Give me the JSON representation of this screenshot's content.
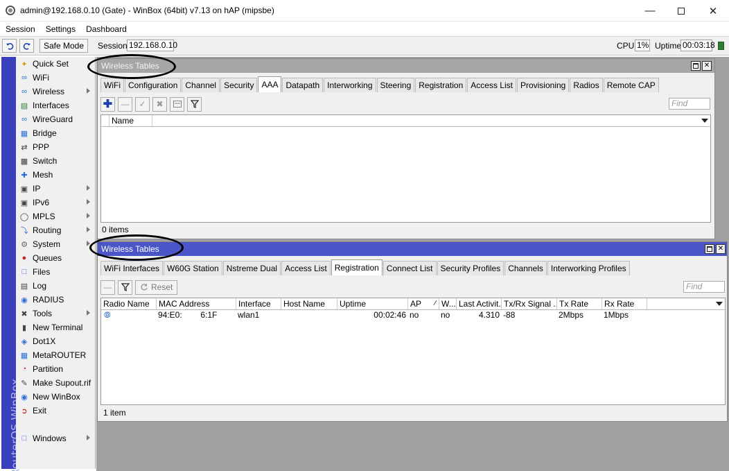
{
  "window": {
    "title": "admin@192.168.0.10 (Gate) - WinBox (64bit) v7.13 on hAP (mipsbe)"
  },
  "menubar": [
    "Session",
    "Settings",
    "Dashboard"
  ],
  "toolbar": {
    "safe_mode_label": "Safe Mode",
    "session_label": "Session:",
    "session_value": "192.168.0.10",
    "cpu_label": "CPU:",
    "cpu_value": "1%",
    "uptime_label": "Uptime:",
    "uptime_value": "00:03:18"
  },
  "brand_strip_text": "RouterOS WinBox",
  "sidebar": {
    "items": [
      {
        "label": "Quick Set",
        "icon": "wand-icon",
        "submenu": false
      },
      {
        "label": "WiFi",
        "icon": "wifi-icon",
        "submenu": false
      },
      {
        "label": "Wireless",
        "icon": "wireless-icon",
        "submenu": true
      },
      {
        "label": "Interfaces",
        "icon": "interfaces-icon",
        "submenu": false
      },
      {
        "label": "WireGuard",
        "icon": "wireguard-icon",
        "submenu": false
      },
      {
        "label": "Bridge",
        "icon": "bridge-icon",
        "submenu": false
      },
      {
        "label": "PPP",
        "icon": "ppp-icon",
        "submenu": false
      },
      {
        "label": "Switch",
        "icon": "switch-icon",
        "submenu": false
      },
      {
        "label": "Mesh",
        "icon": "mesh-icon",
        "submenu": false
      },
      {
        "label": "IP",
        "icon": "ip-icon",
        "submenu": true
      },
      {
        "label": "IPv6",
        "icon": "ipv6-icon",
        "submenu": true
      },
      {
        "label": "MPLS",
        "icon": "mpls-icon",
        "submenu": true
      },
      {
        "label": "Routing",
        "icon": "routing-icon",
        "submenu": true
      },
      {
        "label": "System",
        "icon": "gear-icon",
        "submenu": true
      },
      {
        "label": "Queues",
        "icon": "queues-icon",
        "submenu": false
      },
      {
        "label": "Files",
        "icon": "folder-icon",
        "submenu": false
      },
      {
        "label": "Log",
        "icon": "log-icon",
        "submenu": false
      },
      {
        "label": "RADIUS",
        "icon": "radius-icon",
        "submenu": false
      },
      {
        "label": "Tools",
        "icon": "tools-icon",
        "submenu": true
      },
      {
        "label": "New Terminal",
        "icon": "terminal-icon",
        "submenu": false
      },
      {
        "label": "Dot1X",
        "icon": "dot1x-icon",
        "submenu": false
      },
      {
        "label": "MetaROUTER",
        "icon": "metarouter-icon",
        "submenu": false
      },
      {
        "label": "Partition",
        "icon": "partition-icon",
        "submenu": false
      },
      {
        "label": "Make Supout.rif",
        "icon": "supout-icon",
        "submenu": false
      },
      {
        "label": "New WinBox",
        "icon": "winbox-icon",
        "submenu": false
      },
      {
        "label": "Exit",
        "icon": "exit-icon",
        "submenu": false
      }
    ],
    "windows_item": {
      "label": "Windows",
      "icon": "windows-icon",
      "submenu": true
    }
  },
  "win1": {
    "title": "Wireless Tables",
    "tabs": [
      "WiFi",
      "Configuration",
      "Channel",
      "Security",
      "AAA",
      "Datapath",
      "Interworking",
      "Steering",
      "Registration",
      "Access List",
      "Provisioning",
      "Radios",
      "Remote CAP"
    ],
    "active_tab": 4,
    "find_placeholder": "Find",
    "columns": [
      "Name"
    ],
    "footer": "0 items"
  },
  "win2": {
    "title": "Wireless Tables",
    "tabs": [
      "WiFi Interfaces",
      "W60G Station",
      "Nstreme Dual",
      "Access List",
      "Registration",
      "Connect List",
      "Security Profiles",
      "Channels",
      "Interworking Profiles"
    ],
    "active_tab": 4,
    "reset_label": "Reset",
    "find_placeholder": "Find",
    "columns": [
      "Radio Name",
      "MAC Address",
      "Interface",
      "Host Name",
      "Uptime",
      "AP",
      "W...",
      "Last Activit...",
      "Tx/Rx Signal ...",
      "Tx Rate",
      "Rx Rate"
    ],
    "rows": [
      {
        "radio_name": "",
        "mac": "94:E0:        6:1F",
        "interface": "wlan1",
        "host_name": "",
        "uptime": "00:02:46",
        "ap": "no",
        "w": "no",
        "last_activity": "4.310",
        "signal": "-88",
        "tx_rate": "2Mbps",
        "rx_rate": "1Mbps"
      }
    ],
    "footer": "1 item"
  }
}
